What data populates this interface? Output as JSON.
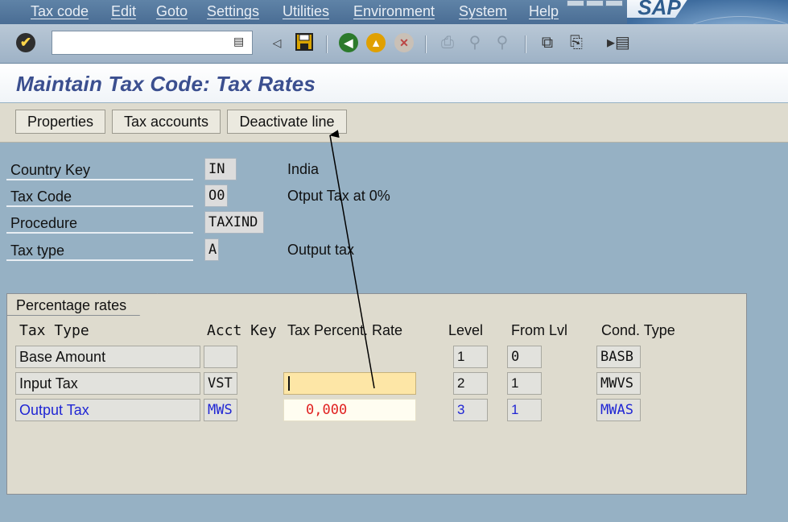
{
  "menu": [
    "Tax code",
    "Edit",
    "Goto",
    "Settings",
    "Utilities",
    "Environment",
    "System",
    "Help"
  ],
  "logo": "SAP",
  "toolbar_icons": {
    "enter": "check-icon",
    "dropdown": "command-dropdown-icon",
    "back_arrow": "back-triangle-icon",
    "save": "save-icon",
    "back": "back-icon",
    "exit": "exit-icon",
    "cancel": "cancel-icon",
    "print": "print-icon",
    "find": "find-icon",
    "find_next": "find-next-icon",
    "create_session": "create-session-icon",
    "shortcut": "shortcut-icon",
    "help": "help-icon"
  },
  "title": "Maintain Tax Code: Tax Rates",
  "app_toolbar": {
    "properties": "Properties",
    "tax_accounts": "Tax accounts",
    "deactivate_line": "Deactivate line"
  },
  "header": {
    "country_key": {
      "label": "Country Key",
      "value": "IN",
      "desc": "India"
    },
    "tax_code": {
      "label": "Tax Code",
      "value": "O0",
      "desc": "Otput Tax at 0%"
    },
    "procedure": {
      "label": "Procedure",
      "value": "TAXIND"
    },
    "tax_type": {
      "label": "Tax type",
      "value": "A",
      "desc": "Output tax"
    }
  },
  "rates": {
    "group_title": "Percentage rates",
    "columns": {
      "tax_type": "Tax Type",
      "acct_key": "Acct Key",
      "tax_percent_rate": "Tax Percent. Rate",
      "level": "Level",
      "from_lvl": "From Lvl",
      "cond_type": "Cond. Type"
    },
    "rows": [
      {
        "tax_type": "Base Amount",
        "acct_key": "",
        "rate": "",
        "level": "1",
        "from_lvl": "0",
        "cond_type": "BASB"
      },
      {
        "tax_type": "Input Tax",
        "acct_key": "VST",
        "rate": "",
        "level": "2",
        "from_lvl": "1",
        "cond_type": "MWVS"
      },
      {
        "tax_type": "Output Tax",
        "acct_key": "MWS",
        "rate": "0,000",
        "level": "3",
        "from_lvl": "1",
        "cond_type": "MWAS"
      }
    ]
  },
  "colors": {
    "menubar": "#4a6d94",
    "title_text": "#3b4f8f",
    "background": "#96b1c4",
    "group_bg": "#dedbce",
    "input_highlight": "#fde6a6",
    "highlight_row_text": "#2026d4",
    "rate_value": "#e02020"
  }
}
